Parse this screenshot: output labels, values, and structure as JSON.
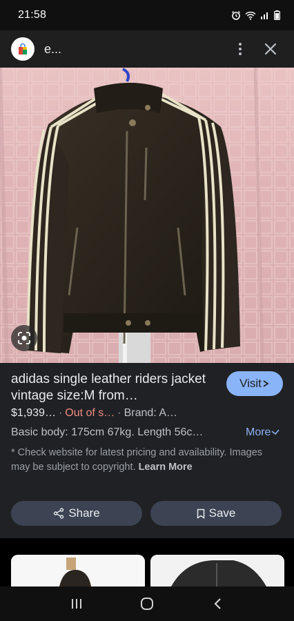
{
  "status_bar": {
    "time": "21:58"
  },
  "header": {
    "site_name": "e...",
    "logo_icon": "shopping-bag-icon",
    "menu_icon": "more-vert-icon",
    "close_icon": "close-icon"
  },
  "image": {
    "alt_subject": "jacket-photo",
    "lens_icon": "google-lens-icon"
  },
  "product": {
    "title": "adidas single leather riders jacket vintage size:M from…",
    "visit_label": "Visit",
    "price": "$1,939…",
    "stock": "Out of s…",
    "brand": "Brand: A…",
    "description": "Basic body: 175cm 67kg. Length 56c…",
    "more_label": "More",
    "disclaimer": "* Check website for latest pricing and availability. Images may be subject to copyright.",
    "learn_more": "Learn More"
  },
  "actions": {
    "share_label": "Share",
    "save_label": "Save"
  },
  "colors": {
    "accent": "#8ab4f8",
    "out_of_stock": "#f28b82",
    "panel_bg": "#202124",
    "button_bg": "#3c4453"
  }
}
